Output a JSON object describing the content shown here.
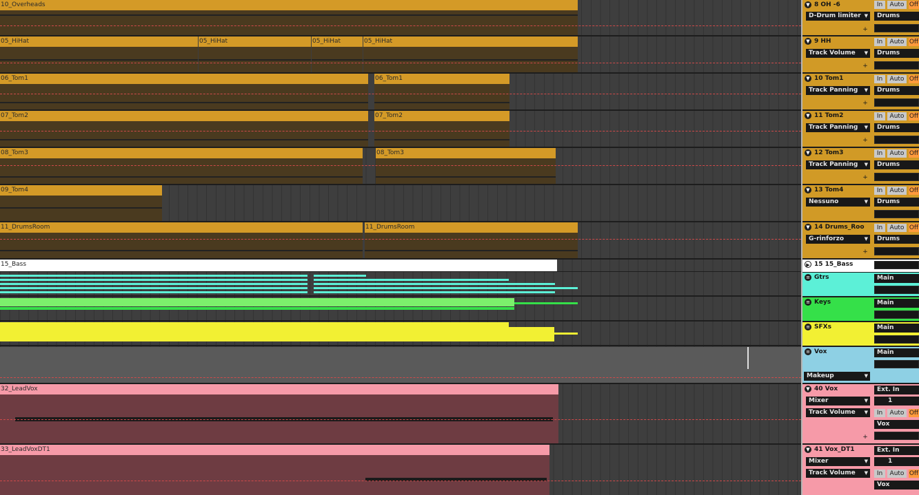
{
  "colors": {
    "drums_bg": "#4a3a1f",
    "drums_head": "#d49a27",
    "drums_header": "#d19a26",
    "bass": "#ffffff",
    "gtrs": "#5cf0d7",
    "keys": "#35e049",
    "sfx": "#f2f033",
    "vox": "#8ed0e4",
    "leadvox_head": "#f69aa8",
    "leadvox_bg": "#6e3c42",
    "group_bg": "#5a5a5a"
  },
  "arrangement": {
    "tracks": [
      {
        "name": "10_Overheads",
        "clips": [
          "10_Overheads"
        ]
      },
      {
        "name": "05_HiHat",
        "clips": [
          "05_HiHat",
          "05_HiHat",
          "05_HiHat",
          "05_HiHat"
        ]
      },
      {
        "name": "06_Tom1",
        "clips": [
          "06_Tom1",
          "06_Tom1"
        ]
      },
      {
        "name": "07_Tom2",
        "clips": [
          "07_Tom2",
          "07_Tom2"
        ]
      },
      {
        "name": "08_Tom3",
        "clips": [
          "08_Tom3",
          "08_Tom3"
        ]
      },
      {
        "name": "09_Tom4",
        "clips": [
          "09_Tom4"
        ]
      },
      {
        "name": "11_DrumsRoom",
        "clips": [
          "11_DrumsRoom",
          "11_DrumsRoom"
        ]
      },
      {
        "name": "15_Bass",
        "clips": [
          "15_Bass"
        ]
      },
      {
        "name": "32_LeadVox",
        "clips": [
          "32_LeadVox"
        ]
      },
      {
        "name": "33_LeadVoxDT1",
        "clips": [
          "33_LeadVoxDT1"
        ]
      }
    ]
  },
  "headers": [
    {
      "name": "8 OH -6",
      "device": "D-Drum limiter",
      "input": "In",
      "auto": "Auto",
      "off": "Off",
      "output": "Drums"
    },
    {
      "name": "9 HH",
      "device": "Track Volume",
      "input": "In",
      "auto": "Auto",
      "off": "Off",
      "output": "Drums"
    },
    {
      "name": "10 Tom1",
      "device": "Track Panning",
      "input": "In",
      "auto": "Auto",
      "off": "Off",
      "output": "Drums"
    },
    {
      "name": "11 Tom2",
      "device": "Track Panning",
      "input": "In",
      "auto": "Auto",
      "off": "Off",
      "output": "Drums"
    },
    {
      "name": "12 Tom3",
      "device": "Track Panning",
      "input": "In",
      "auto": "Auto",
      "off": "Off",
      "output": "Drums"
    },
    {
      "name": "13 Tom4",
      "device": "Nessuno",
      "input": "In",
      "auto": "Auto",
      "off": "Off",
      "output": "Drums"
    },
    {
      "name": "14 Drums_Roo",
      "device": "G-rinforzo",
      "input": "In",
      "auto": "Auto",
      "off": "Off",
      "output": "Drums"
    },
    {
      "name": "15 15_Bass"
    },
    {
      "name": "Gtrs",
      "output": "Main"
    },
    {
      "name": "Keys",
      "output": "Main"
    },
    {
      "name": "SFXs",
      "output": "Main"
    },
    {
      "name": "Vox",
      "output": "Main",
      "device": "Makeup"
    },
    {
      "name": "40 Vox",
      "device": "Mixer",
      "param": "Track Volume",
      "input_type": "Ext. In",
      "channel": "1",
      "input": "In",
      "auto": "Auto",
      "off": "Off",
      "output": "Vox"
    },
    {
      "name": "41 Vox_DT1",
      "device": "Mixer",
      "param": "Track Volume",
      "input_type": "Ext. In",
      "channel": "1",
      "input": "In",
      "auto": "Auto",
      "off": "Off",
      "output": "Vox"
    }
  ],
  "icons": {
    "fold": "triangle-down-icon",
    "play": "play-icon",
    "group": "group-icon",
    "plus": "plus-icon",
    "dropdown": "chevron-down-icon"
  }
}
